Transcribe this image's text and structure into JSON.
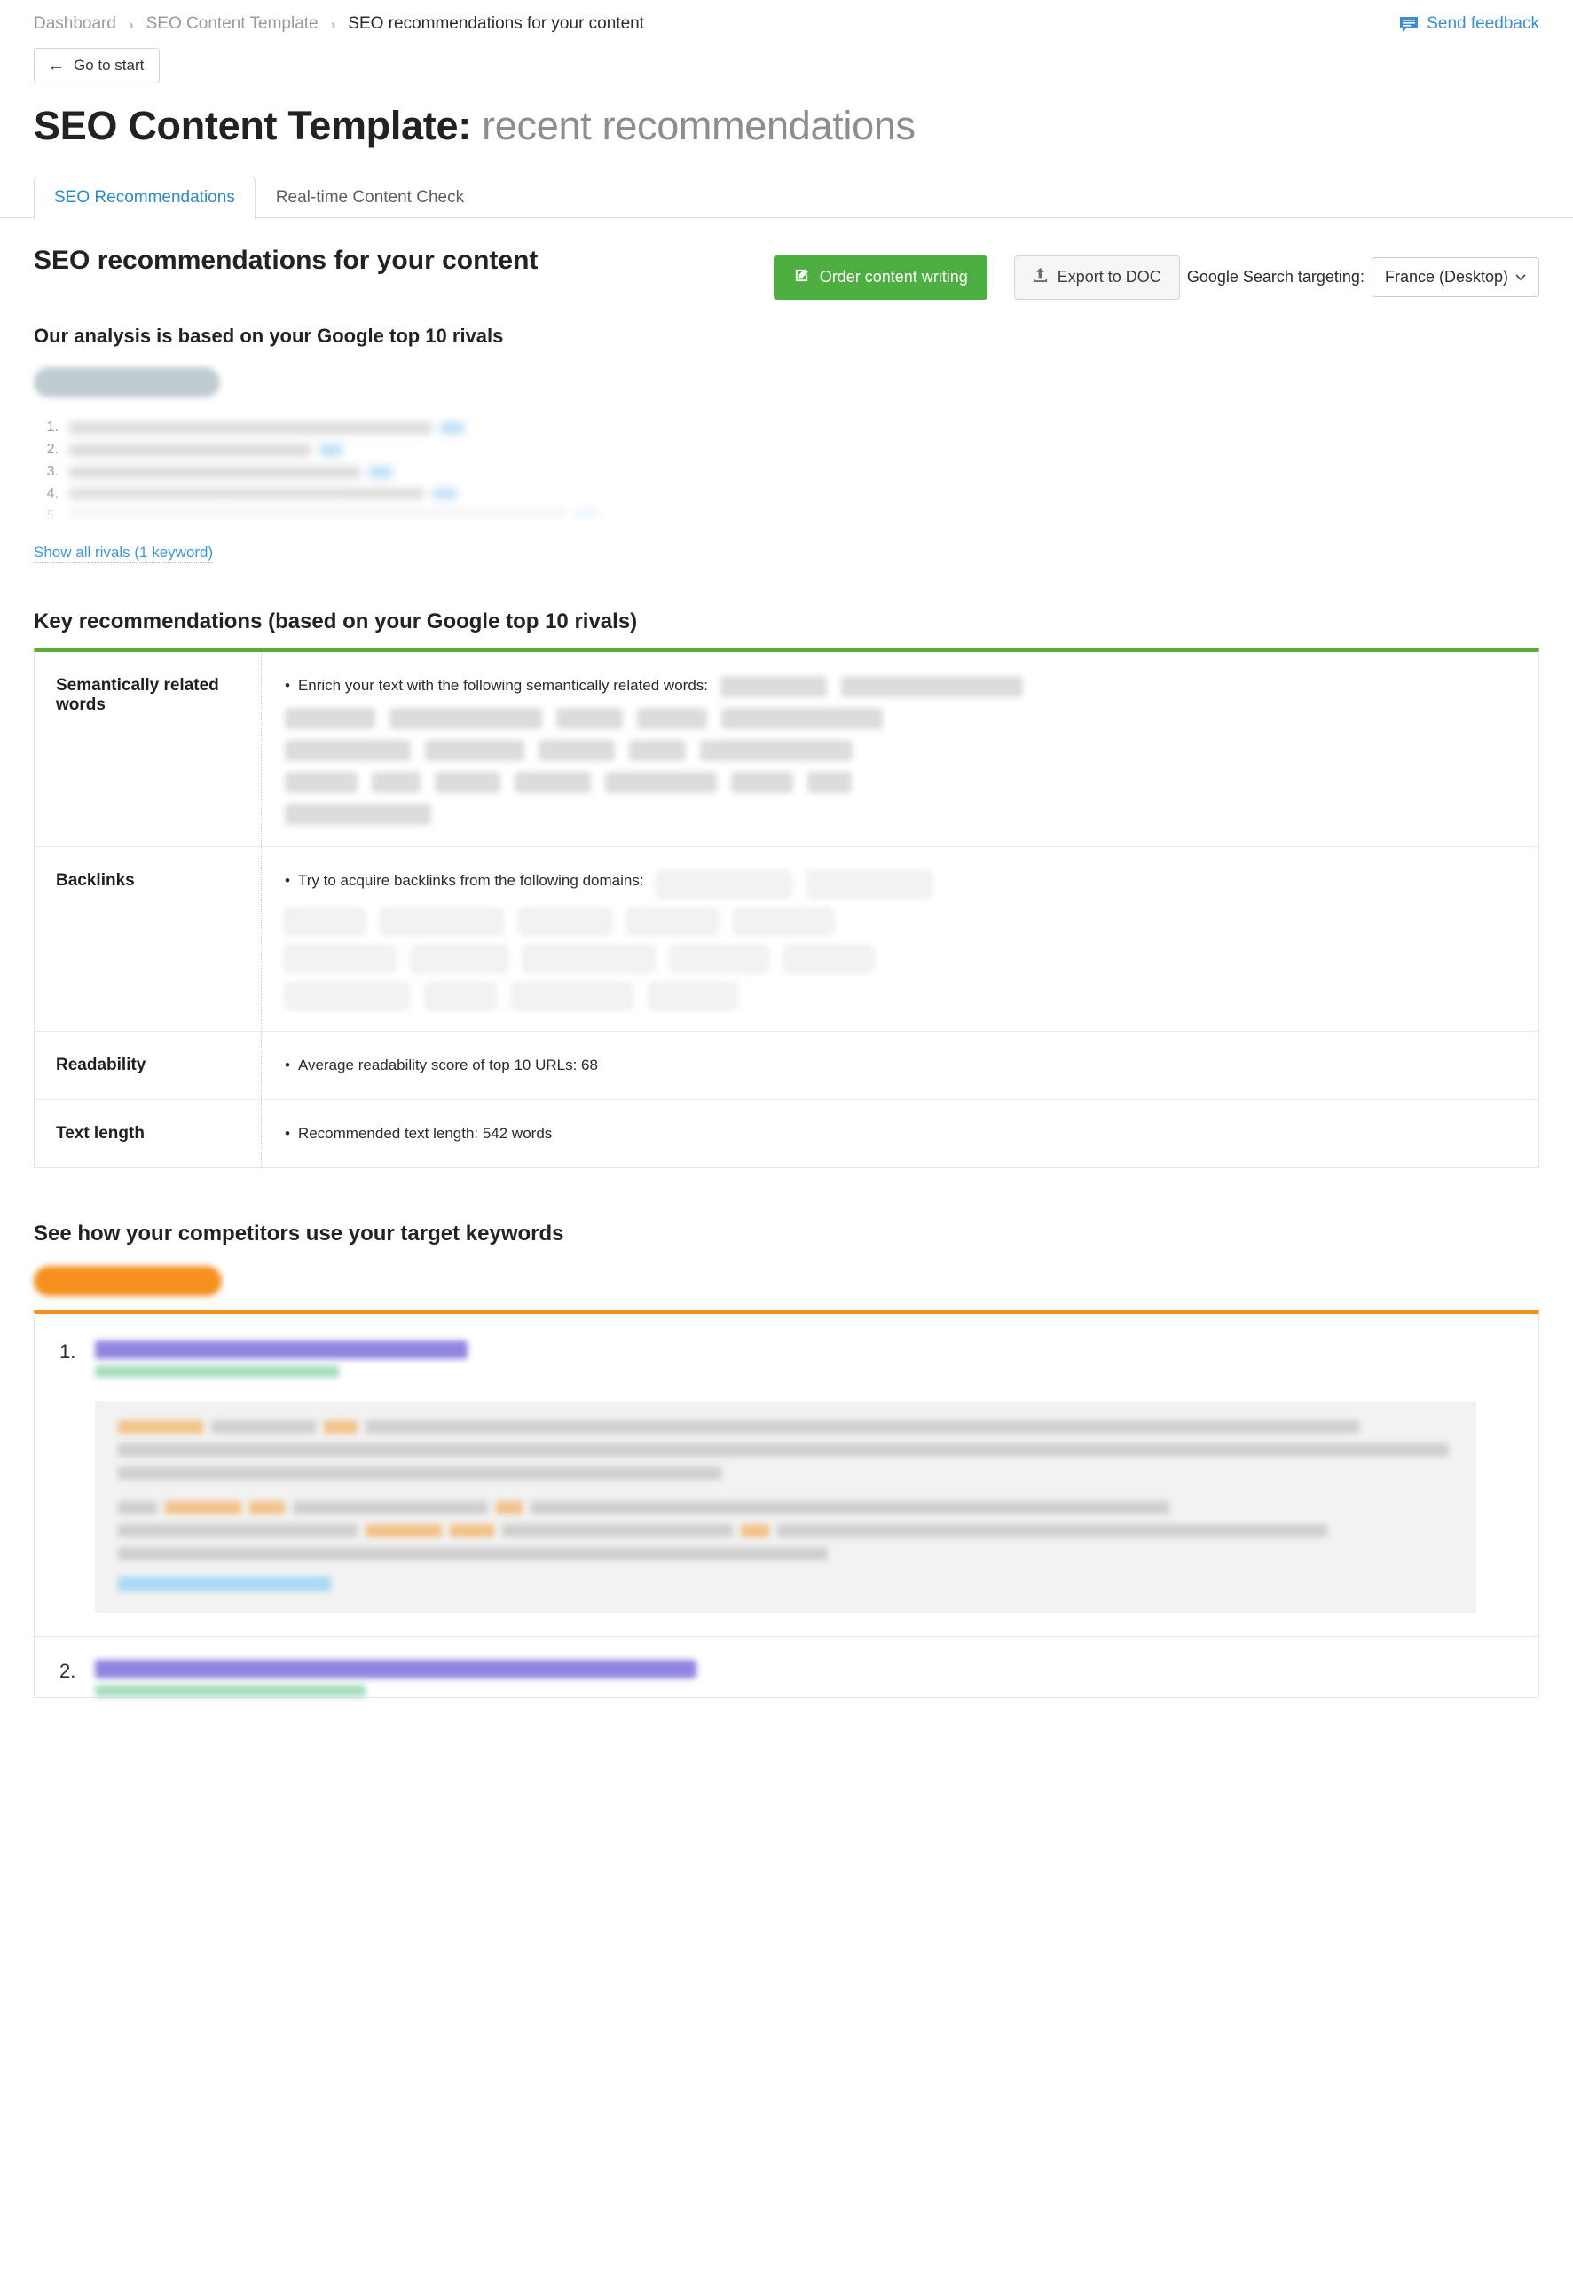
{
  "breadcrumb": {
    "items": [
      {
        "label": "Dashboard",
        "current": false
      },
      {
        "label": "SEO Content Template",
        "current": false
      },
      {
        "label": "SEO recommendations for your content",
        "current": true
      }
    ],
    "separator": "›"
  },
  "feedback": {
    "label": "Send feedback",
    "icon": "speech-bubble-icon",
    "color": "#3a8fd0"
  },
  "back_button": {
    "label": "Go to start",
    "icon": "arrow-left-icon",
    "arrow": "←"
  },
  "page_title": {
    "prefix": "SEO Content Template:",
    "suffix": "recent recommendations"
  },
  "tabs": [
    {
      "label": "SEO Recommendations",
      "active": true
    },
    {
      "label": "Real-time Content Check",
      "active": false
    }
  ],
  "main": {
    "section_title": "SEO recommendations for your content",
    "order_button": {
      "label": "Order content writing",
      "icon": "compose-icon",
      "color": "#4bb040"
    },
    "export_button": {
      "label": "Export to DOC",
      "icon": "upload-icon"
    },
    "targeting": {
      "label": "Google Search targeting:",
      "selected": "France (Desktop)",
      "caret": "⌄"
    },
    "analysis_subtitle": "Our analysis is based on your Google top 10 rivals",
    "rivals_numbers": [
      "1.",
      "2.",
      "3.",
      "4.",
      "5."
    ],
    "show_all_rivals": "Show all rivals (1 keyword)"
  },
  "key_recommendations": {
    "title": "Key recommendations (based on your Google top 10 rivals)",
    "accent_color": "#5aaf33",
    "rows": [
      {
        "label": "Semantically related words",
        "text": "Enrich your text with the following semantically related words:",
        "bullet": "•"
      },
      {
        "label": "Backlinks",
        "text": "Try to acquire backlinks from the following domains:",
        "bullet": "•"
      },
      {
        "label": "Readability",
        "text": "Average readability score of top 10 URLs:  68",
        "bullet": "•"
      },
      {
        "label": "Text length",
        "text": "Recommended text length: 542 words",
        "bullet": "•"
      }
    ]
  },
  "competitors": {
    "title": "See how your competitors use your target keywords",
    "accent_color": "#f5901e",
    "items": [
      {
        "number": "1."
      },
      {
        "number": "2."
      }
    ]
  }
}
